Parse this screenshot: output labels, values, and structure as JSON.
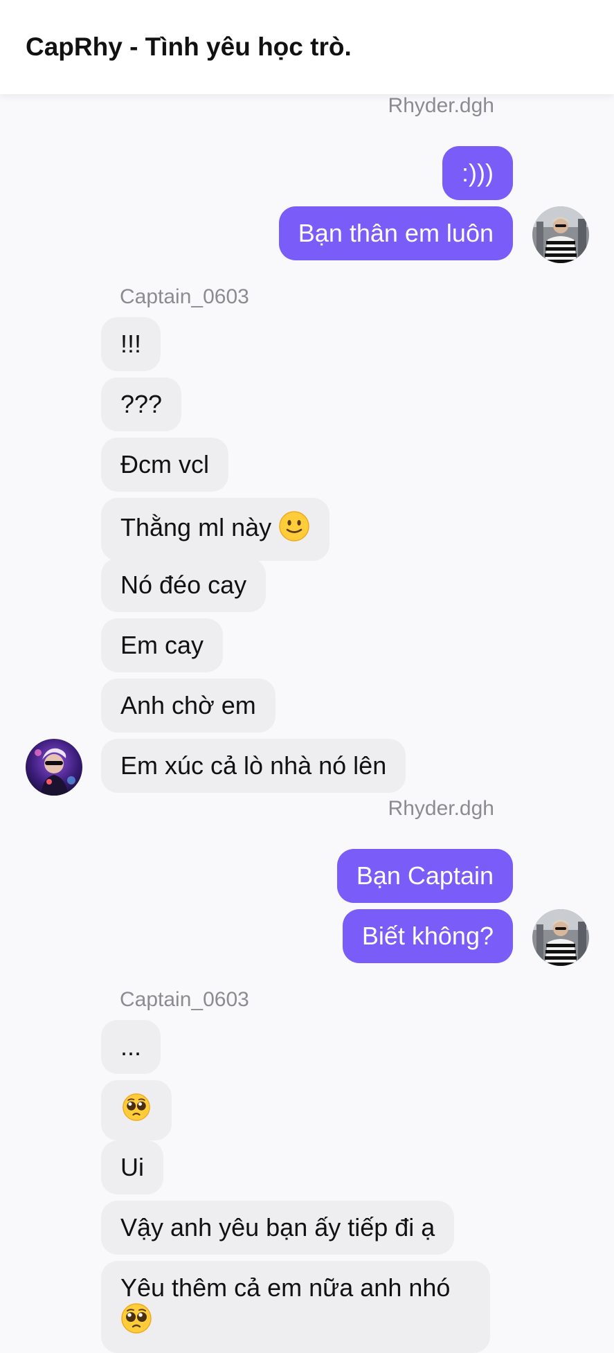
{
  "header": {
    "title": "CapRhy - Tình yêu học trò."
  },
  "groups": [
    {
      "sender": "Rhyder.dgh",
      "messages": [
        ":)))",
        "Bạn thân em luôn"
      ]
    },
    {
      "sender": "Captain_0603",
      "messages": [
        "!!!",
        "???",
        "Đcm vcl",
        "Thằng ml này",
        "Nó đéo cay",
        "Em cay",
        "Anh chờ em",
        "Em xúc cả lò nhà nó lên"
      ]
    },
    {
      "sender": "Rhyder.dgh",
      "messages": [
        "Bạn Captain",
        "Biết không?"
      ]
    },
    {
      "sender": "Captain_0603",
      "messages": [
        "...",
        "",
        "Ui",
        "Vậy anh yêu bạn ấy tiếp đi ạ",
        "Yêu thêm cả em nữa anh nhó"
      ]
    }
  ],
  "icons": {
    "slight_smile": "slightly-smiling-face-emoji",
    "pleading": "pleading-face-emoji"
  },
  "colors": {
    "outgoing_bubble": "#7a5cf8",
    "incoming_bubble": "#eeeef0",
    "background": "#f9f9fb",
    "sender_name": "#8c8c90"
  }
}
